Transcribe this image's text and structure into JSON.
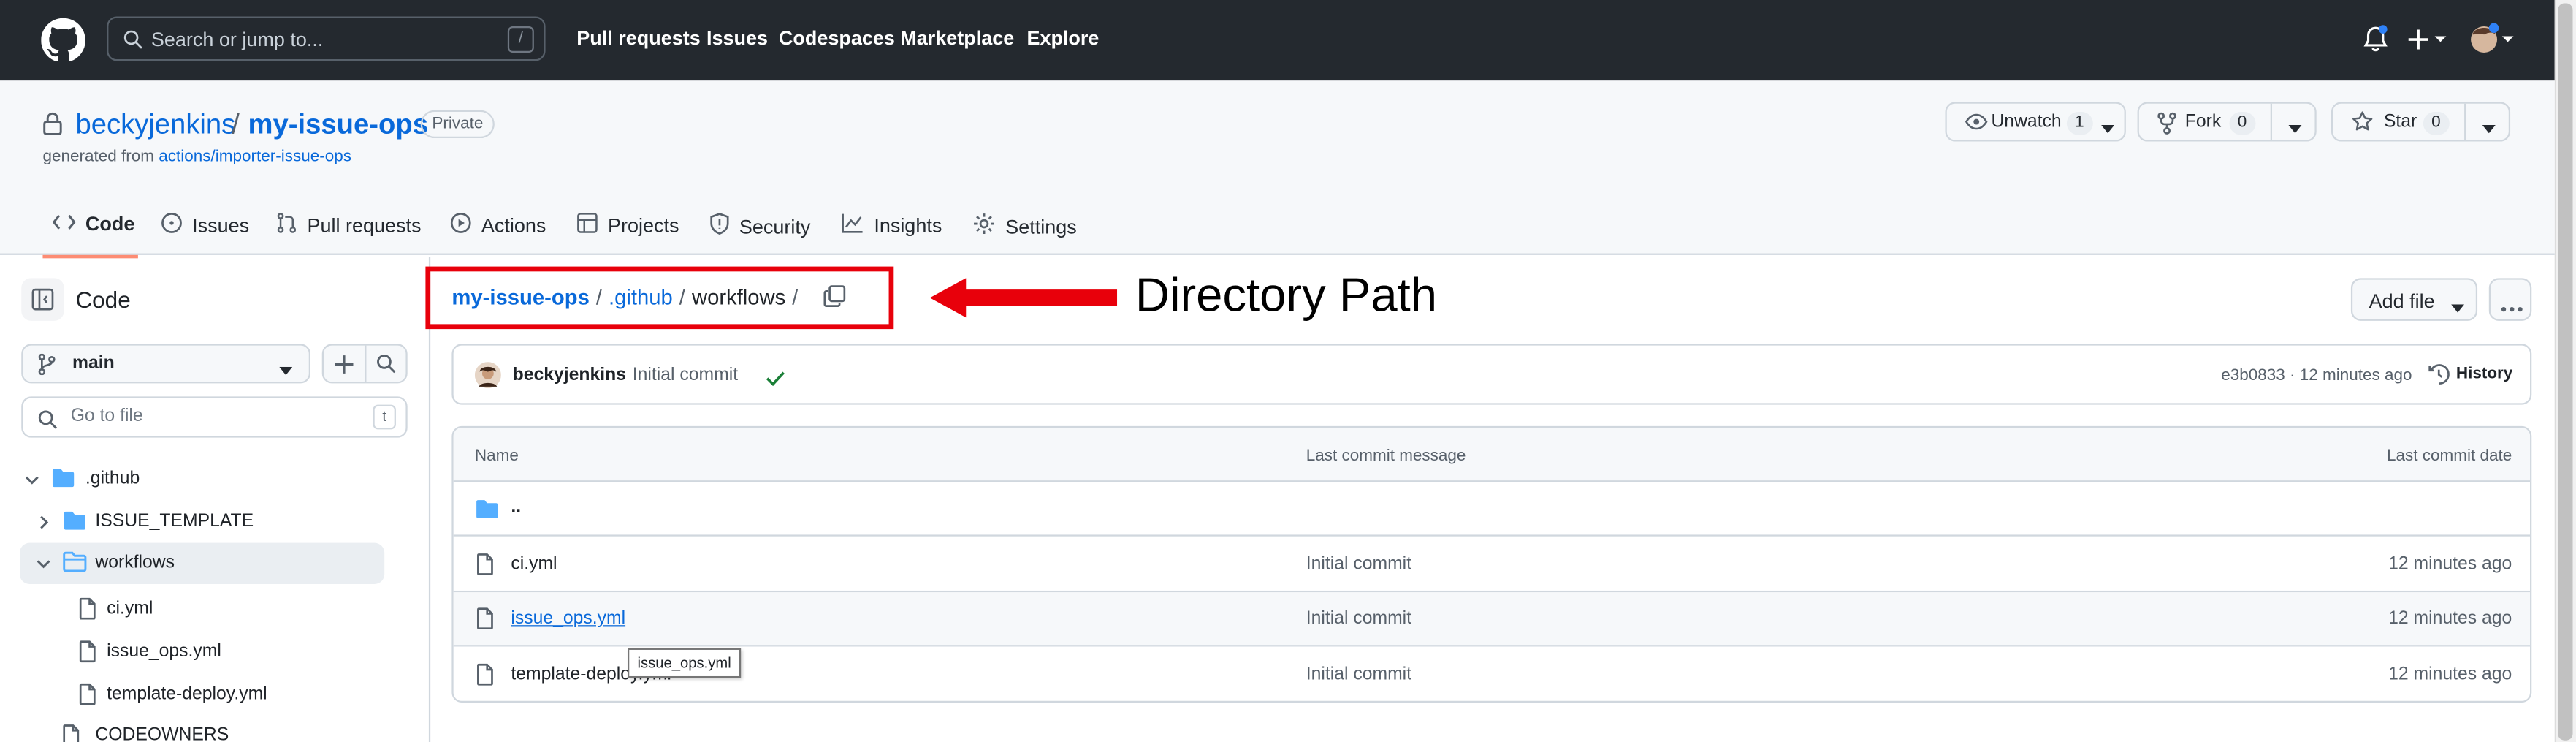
{
  "header": {
    "search_placeholder": "Search or jump to...",
    "search_key": "/",
    "nav": [
      "Pull requests",
      "Issues",
      "Codespaces",
      "Marketplace",
      "Explore"
    ]
  },
  "repo": {
    "owner": "beckyjenkins",
    "separator": "/",
    "name": "my-issue-ops",
    "visibility": "Private",
    "generated_prefix": "generated from",
    "generated_from": "actions/importer-issue-ops",
    "unwatch_label": "Unwatch",
    "unwatch_count": "1",
    "fork_label": "Fork",
    "fork_count": "0",
    "star_label": "Star",
    "star_count": "0"
  },
  "tabs": [
    "Code",
    "Issues",
    "Pull requests",
    "Actions",
    "Projects",
    "Security",
    "Insights",
    "Settings"
  ],
  "sidebar": {
    "title": "Code",
    "branch": "main",
    "go_to_file_placeholder": "Go to file",
    "go_to_file_key": "t",
    "tree": [
      {
        "label": ".github",
        "type": "folder"
      },
      {
        "label": "ISSUE_TEMPLATE",
        "type": "folder"
      },
      {
        "label": "workflows",
        "type": "folder"
      },
      {
        "label": "ci.yml",
        "type": "file"
      },
      {
        "label": "issue_ops.yml",
        "type": "file"
      },
      {
        "label": "template-deploy.yml",
        "type": "file"
      },
      {
        "label": "CODEOWNERS",
        "type": "file"
      }
    ]
  },
  "breadcrumb": {
    "repo": "my-issue-ops",
    "sep": "/",
    "dir1": ".github",
    "current": "workflows",
    "trail": "/"
  },
  "annotation": {
    "label": "Directory Path",
    "color": "#e8000b"
  },
  "actions": {
    "add_file": "Add file"
  },
  "commit": {
    "author": "beckyjenkins",
    "message": "Initial commit",
    "meta": "e3b0833 · 12 minutes ago",
    "history": "History"
  },
  "table": {
    "headers": {
      "name": "Name",
      "message": "Last commit message",
      "date": "Last commit date"
    },
    "parent": "..",
    "rows": [
      {
        "name": "ci.yml",
        "message": "Initial commit",
        "date": "12 minutes ago"
      },
      {
        "name": "issue_ops.yml",
        "message": "Initial commit",
        "date": "12 minutes ago"
      },
      {
        "name": "template-deploy.yml",
        "message": "Initial commit",
        "date": "12 minutes ago"
      }
    ],
    "tooltip": "issue_ops.yml"
  },
  "colors": {
    "header_bg": "#24292f",
    "link": "#0969da",
    "tab_underline": "#fd8c73",
    "folder": "#54aeff",
    "check": "#1a7f37"
  }
}
